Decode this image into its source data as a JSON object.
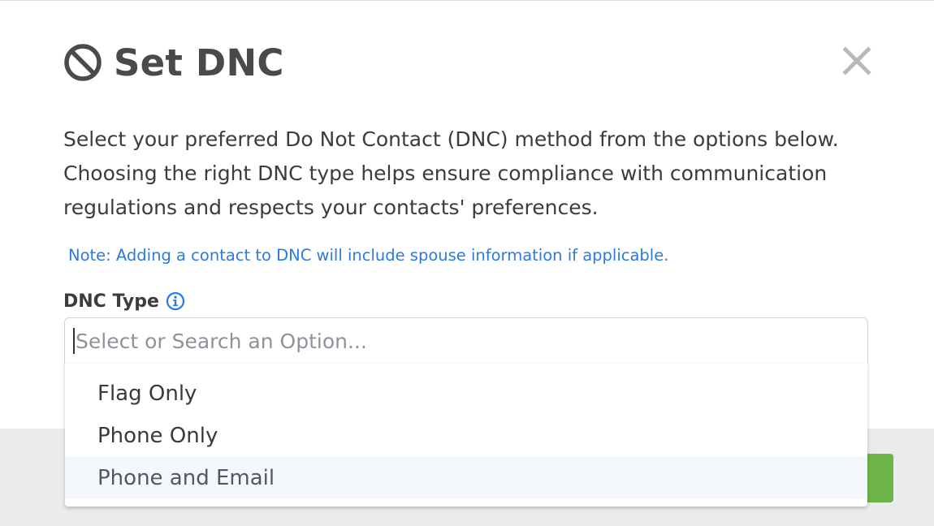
{
  "modal": {
    "title": "Set DNC",
    "close_label": "×",
    "description": "Select your preferred Do Not Contact (DNC) method from the options below. Choosing the right DNC type helps ensure compliance with communication regulations and respects your contacts' preferences.",
    "note": "Note: Adding a contact to DNC will include spouse information if applicable."
  },
  "form": {
    "dnc_type_label": "DNC Type",
    "select_placeholder": "Select or Search an Option...",
    "select_value": ""
  },
  "dropdown": {
    "options": [
      {
        "label": "Flag Only"
      },
      {
        "label": "Phone Only"
      },
      {
        "label": "Phone and Email"
      }
    ],
    "highlighted_index": 2
  },
  "icons": {
    "title_icon": "ban-icon",
    "info_icon": "info-icon",
    "close_icon": "close-icon"
  },
  "colors": {
    "title": "#4a4a4a",
    "note": "#2a7ae2",
    "info": "#2a7ae2",
    "footer": "#e9ebed",
    "confirm_button": "#6fb34b",
    "highlight_row": "#f4f8fc"
  }
}
